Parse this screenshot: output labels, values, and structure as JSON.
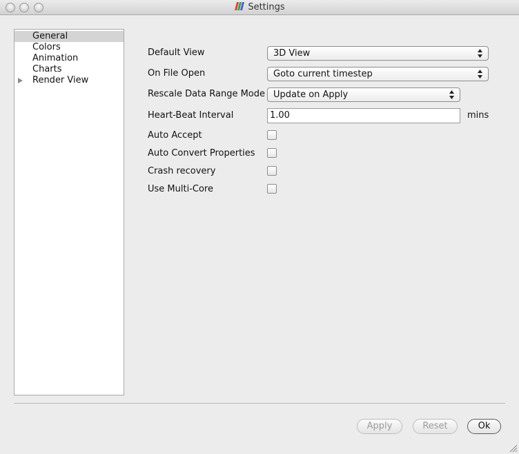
{
  "window": {
    "title": "Settings"
  },
  "sidebar": {
    "items": [
      {
        "label": "General",
        "selected": true
      },
      {
        "label": "Colors"
      },
      {
        "label": "Animation"
      },
      {
        "label": "Charts"
      },
      {
        "label": "Render View",
        "expandable": true
      }
    ]
  },
  "general": {
    "default_view": {
      "label": "Default View",
      "value": "3D View"
    },
    "on_file_open": {
      "label": "On File Open",
      "value": "Goto current timestep"
    },
    "rescale_mode": {
      "label": "Rescale Data Range Mode",
      "value": "Update on Apply"
    },
    "heartbeat": {
      "label": "Heart-Beat Interval",
      "value": "1.00",
      "unit": "mins"
    },
    "auto_accept": {
      "label": "Auto Accept",
      "checked": false
    },
    "auto_convert": {
      "label": "Auto Convert Properties",
      "checked": false
    },
    "crash_recovery": {
      "label": "Crash recovery",
      "checked": false
    },
    "multi_core": {
      "label": "Use Multi-Core",
      "checked": false
    }
  },
  "buttons": {
    "apply": "Apply",
    "reset": "Reset",
    "ok": "Ok"
  },
  "icons": {
    "app": "paraview-logo-icon",
    "tree_expand": "disclosure-triangle-icon",
    "combo": "up-down-chevron-icon",
    "resize": "resize-grip-icon"
  }
}
